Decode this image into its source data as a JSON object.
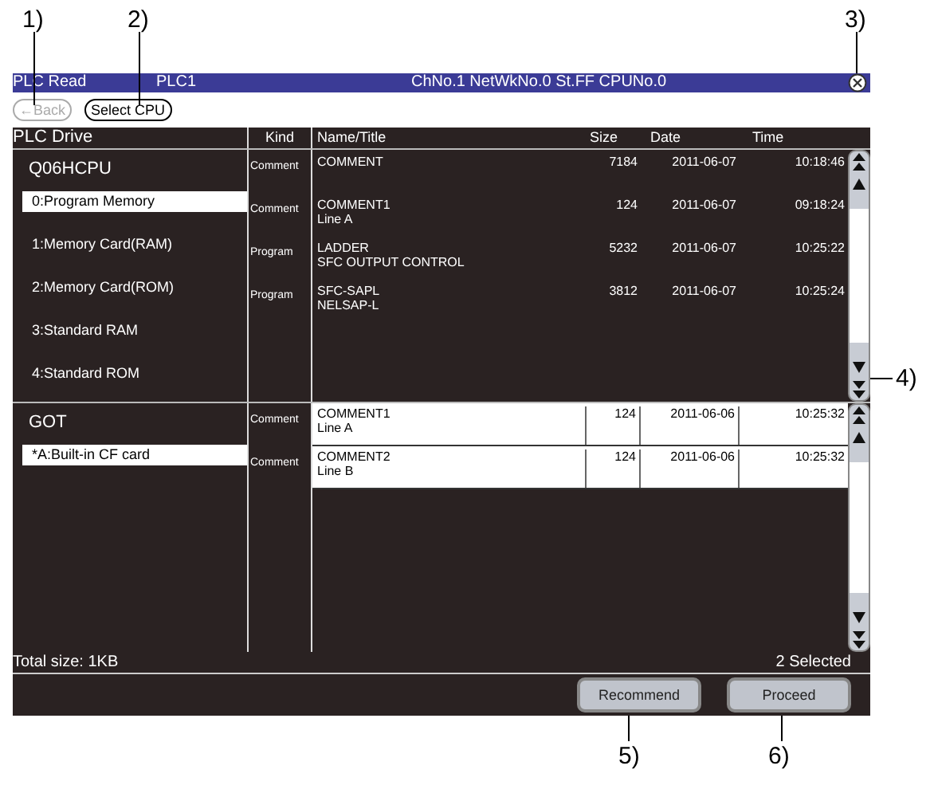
{
  "callouts": [
    "1)",
    "2)",
    "3)",
    "4)",
    "5)",
    "6)"
  ],
  "title_bar": {
    "title": "PLC Read",
    "station": "PLC1",
    "info": "ChNo.1 NetWkNo.0 St.FF CPUNo.0"
  },
  "toolbar": {
    "back": {
      "label": "←Back",
      "disabled": true
    },
    "select_cpu": {
      "label": "Select CPU",
      "disabled": false
    }
  },
  "drive_panel": {
    "heading": "PLC Drive",
    "groups": [
      {
        "name": "Q06HCPU",
        "items": [
          {
            "label": "0:Program Memory",
            "selected": true
          },
          {
            "label": "1:Memory Card(RAM)",
            "selected": false
          },
          {
            "label": "2:Memory Card(ROM)",
            "selected": false
          },
          {
            "label": "3:Standard RAM",
            "selected": false
          },
          {
            "label": "4:Standard ROM",
            "selected": false
          }
        ]
      },
      {
        "name": "GOT",
        "items": [
          {
            "label": "*A:Built-in CF card",
            "selected": true
          }
        ]
      }
    ]
  },
  "table": {
    "columns": [
      "Kind",
      "Name/Title",
      "Size",
      "Date",
      "Time"
    ],
    "groups": [
      {
        "rows": [
          {
            "kind": "Comment",
            "name": "COMMENT",
            "subtitle": null,
            "size": "7184",
            "date": "2011-06-07",
            "time": "10:18:46",
            "selected": false
          },
          {
            "kind": "Comment",
            "name": "COMMENT1",
            "subtitle": "Line A",
            "size": "124",
            "date": "2011-06-07",
            "time": "09:18:24",
            "selected": false
          },
          {
            "kind": "Program",
            "name": "LADDER",
            "subtitle": "SFC OUTPUT CONTROL",
            "size": "5232",
            "date": "2011-06-07",
            "time": "10:25:22",
            "selected": false
          },
          {
            "kind": "Program",
            "name": "SFC-SAPL",
            "subtitle": "NELSAP-L",
            "size": "3812",
            "date": "2011-06-07",
            "time": "10:25:24",
            "selected": false
          }
        ]
      },
      {
        "rows": [
          {
            "kind": "Comment",
            "name": "COMMENT1",
            "subtitle": "Line A",
            "size": "124",
            "date": "2011-06-06",
            "time": "10:25:32",
            "selected": true
          },
          {
            "kind": "Comment",
            "name": "COMMENT2",
            "subtitle": "Line B",
            "size": "124",
            "date": "2011-06-06",
            "time": "10:25:32",
            "selected": true
          }
        ]
      }
    ]
  },
  "status_bar": {
    "total": "Total size: 1KB",
    "selected_count": "2 Selected"
  },
  "buttons": [
    "Recommend",
    "Proceed"
  ]
}
